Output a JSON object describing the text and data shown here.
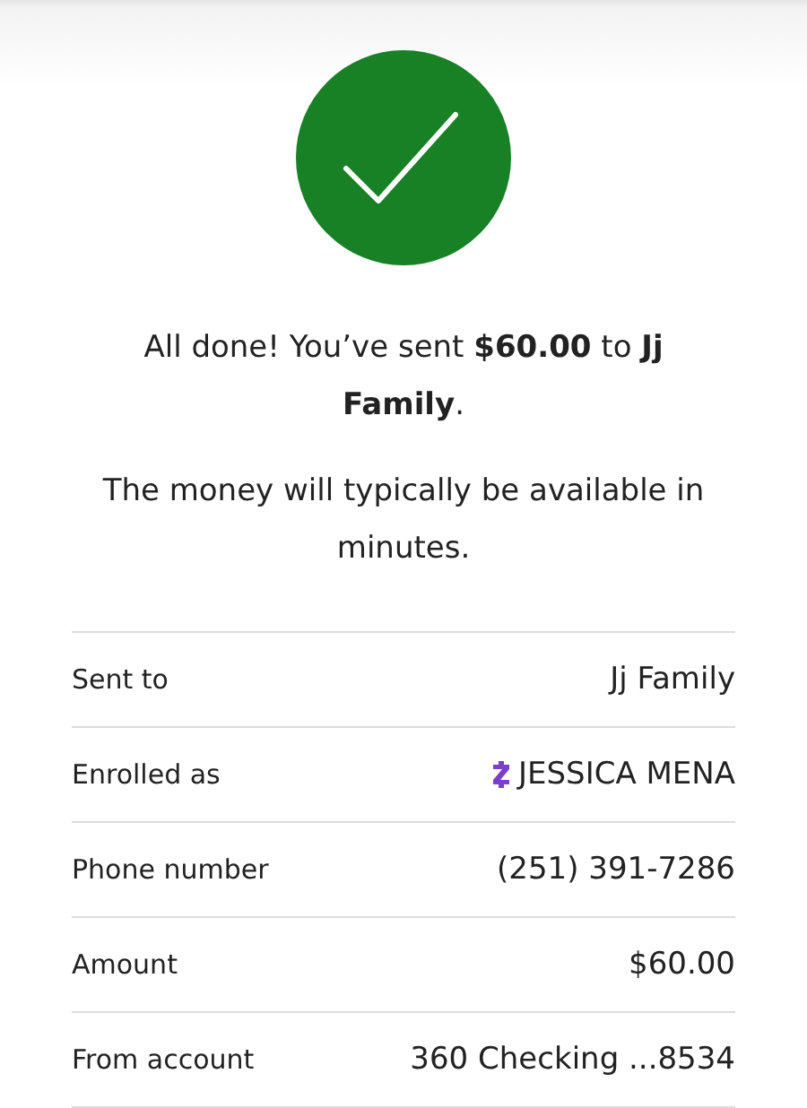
{
  "status": {
    "kind": "success"
  },
  "message": "All done! You’ve sent **$60.00** to **Jj Family**.",
  "note": "The money will typically be available in minutes.",
  "details": [
    {
      "kind": "plain",
      "label": "Sent to",
      "value": "Jj Family"
    },
    {
      "kind": "enrolled",
      "label": "Enrolled as",
      "value": "JESSICA MENA"
    },
    {
      "kind": "plain",
      "label": "Phone number",
      "value": "(251) 391-7286"
    },
    {
      "kind": "plain",
      "label": "Amount",
      "value": "$60.00"
    },
    {
      "kind": "plain",
      "label": "From account",
      "value": "360 Checking ...8534"
    }
  ]
}
